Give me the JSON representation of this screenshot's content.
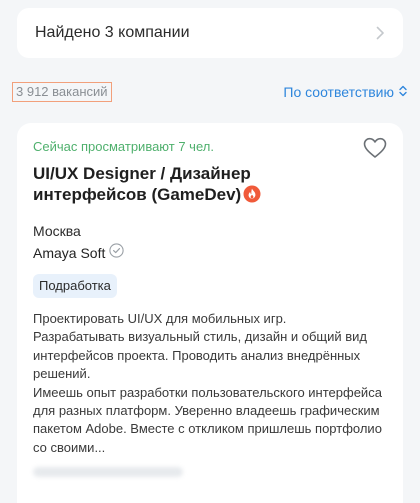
{
  "companies": {
    "label": "Найдено 3 компании",
    "chevron_icon": "chevron-right-icon"
  },
  "results": {
    "count_label": "3 912 вакансий",
    "sort_label": "По соответствию",
    "sort_icon": "sort-arrows-icon"
  },
  "vacancy": {
    "viewers_text": "Сейчас просматривают 7 чел.",
    "title": "UI/UX Designer / Дизайнер интерфейсов (GameDev)",
    "hot_icon": "fire-icon",
    "favorite_icon": "heart-outline-icon",
    "city": "Москва",
    "employer": "Amaya Soft",
    "verified_icon": "check-circle-icon",
    "tag": "Подработка",
    "description": "Проектировать UI/UX для мобильных игр.\nРазрабатывать визуальный стиль, дизайн и общий вид интерфейсов проекта. Проводить анализ внедрённых решений.\nИмеешь опыт разработки пользовательского интерфейса для разных платформ. Уверенно владеешь графическим пакетом Adobe. Вместе с откликом пришлешь портфолио со своими..."
  },
  "colors": {
    "accent_blue": "#2e86dc",
    "viewers_green": "#4fb06d",
    "hot_red": "#f05a3a",
    "tag_bg": "#e8f1fb",
    "highlight_border": "#f2a07b"
  }
}
